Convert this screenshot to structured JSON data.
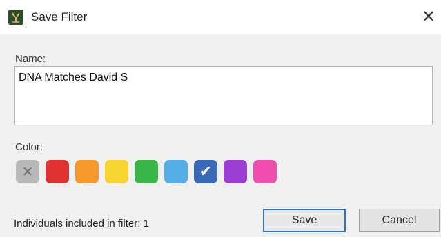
{
  "window": {
    "title": "Save Filter",
    "close_glyph": "✕",
    "icon": "tree-app-icon"
  },
  "form": {
    "name_label": "Name:",
    "name_value": "DNA Matches David S",
    "color_label": "Color:"
  },
  "colors": [
    {
      "name": "none",
      "hex": "#b9b9b9",
      "glyph": "✕",
      "selected": false
    },
    {
      "name": "red",
      "hex": "#e03232",
      "glyph": "",
      "selected": false
    },
    {
      "name": "orange",
      "hex": "#f79a2e",
      "glyph": "",
      "selected": false
    },
    {
      "name": "yellow",
      "hex": "#f6d432",
      "glyph": "",
      "selected": false
    },
    {
      "name": "green",
      "hex": "#39b54a",
      "glyph": "",
      "selected": false
    },
    {
      "name": "light-blue",
      "hex": "#56aee6",
      "glyph": "",
      "selected": false
    },
    {
      "name": "blue",
      "hex": "#3a6ab5",
      "glyph": "✔",
      "selected": true
    },
    {
      "name": "purple",
      "hex": "#9b3ed3",
      "glyph": "",
      "selected": false
    },
    {
      "name": "pink",
      "hex": "#f14fb0",
      "glyph": "",
      "selected": false
    }
  ],
  "footer": {
    "status": "Individuals included in filter: 1",
    "save_label": "Save",
    "cancel_label": "Cancel"
  }
}
